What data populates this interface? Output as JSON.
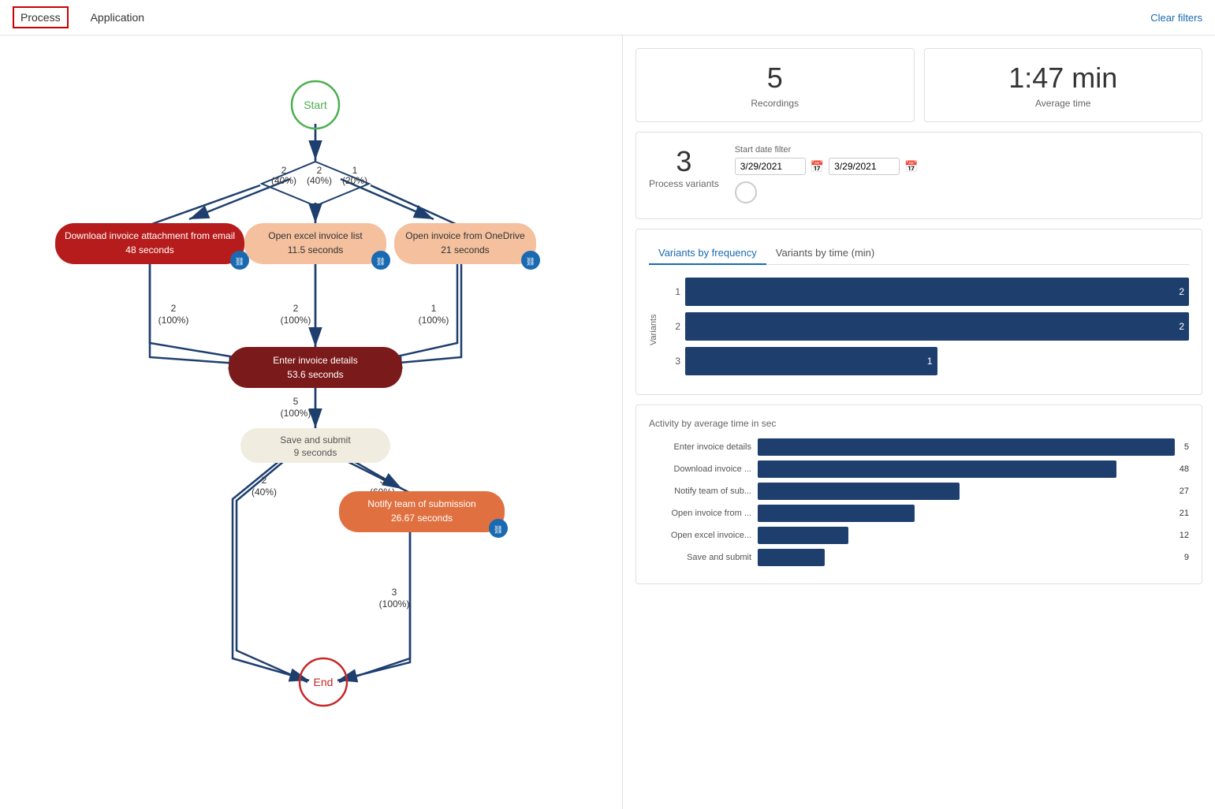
{
  "nav": {
    "tabs": [
      "Process",
      "Application"
    ],
    "active_tab": "Process",
    "clear_filters": "Clear filters"
  },
  "stats": {
    "recordings": {
      "value": "5",
      "label": "Recordings"
    },
    "avg_time": {
      "value": "1:47 min",
      "label": "Average time"
    },
    "process_variants": {
      "value": "3",
      "label": "Process variants"
    }
  },
  "date_filter": {
    "label": "Start date filter",
    "from": "3/29/2021",
    "to": "3/29/2021"
  },
  "frequency_chart": {
    "tab1": "Variants by frequency",
    "tab2": "Variants by time (min)",
    "y_axis_label": "Variants",
    "bars": [
      {
        "label": "1",
        "value": 2,
        "pct": 100
      },
      {
        "label": "2",
        "value": 2,
        "pct": 100
      },
      {
        "label": "3",
        "value": 1,
        "pct": 50
      }
    ]
  },
  "activity_chart": {
    "title": "Activity by average time in sec",
    "max_val": 55,
    "bars": [
      {
        "label": "Enter invoice details",
        "value": 55,
        "display": "5"
      },
      {
        "label": "Download invoice ...",
        "value": 48,
        "display": "48"
      },
      {
        "label": "Notify team of sub...",
        "value": 27,
        "display": "27"
      },
      {
        "label": "Open invoice from ...",
        "value": 21,
        "display": "21"
      },
      {
        "label": "Open excel invoice...",
        "value": 12,
        "display": "12"
      },
      {
        "label": "Save and submit",
        "value": 9,
        "display": "9"
      }
    ]
  },
  "flow": {
    "nodes": {
      "start": "Start",
      "end": "End",
      "download": "Download invoice attachment from email\n48 seconds",
      "open_excel": "Open excel invoice list\n11.5 seconds",
      "open_onedrive": "Open invoice from OneDrive\n21 seconds",
      "enter_details": "Enter invoice details\n53.6 seconds",
      "save_submit": "Save and submit\n9 seconds",
      "notify": "Notify team of submission\n26.67 seconds"
    },
    "edges": {
      "start_download": {
        "count": "2",
        "pct": "(40%)"
      },
      "start_excel": {
        "count": "2",
        "pct": "(40%)"
      },
      "start_onedrive": {
        "count": "1",
        "pct": "(20%)"
      },
      "download_enter": {
        "count": "2",
        "pct": "(100%)"
      },
      "excel_enter": {
        "count": "2",
        "pct": "(100%)"
      },
      "onedrive_enter": {
        "count": "1",
        "pct": "(100%)"
      },
      "enter_save": {
        "count": "5",
        "pct": "(100%)"
      },
      "save_notify": {
        "count": "3",
        "pct": "(60%)"
      },
      "save_end": {
        "count": "2",
        "pct": "(40%)"
      },
      "notify_end": {
        "count": "3",
        "pct": "(100%)"
      }
    }
  }
}
